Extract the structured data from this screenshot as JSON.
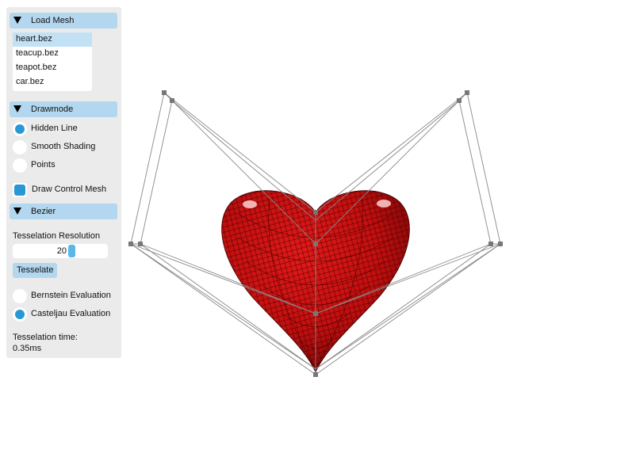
{
  "load_mesh": {
    "title": "Load Mesh",
    "items": [
      "heart.bez",
      "teacup.bez",
      "teapot.bez",
      "car.bez"
    ],
    "selected": "heart.bez"
  },
  "drawmode": {
    "title": "Drawmode",
    "options": [
      "Hidden Line",
      "Smooth Shading",
      "Points"
    ],
    "selected": "Hidden Line",
    "draw_control_mesh_label": "Draw Control Mesh",
    "draw_control_mesh_checked": true
  },
  "bezier": {
    "title": "Bezier",
    "resolution_label": "Tesselation Resolution",
    "resolution_value": "20",
    "tesselate_button": "Tesselate",
    "evaluation_options": [
      "Bernstein Evaluation",
      "Casteljau Evaluation"
    ],
    "evaluation_selected": "Casteljau Evaluation",
    "time_label": "Tesselation time:",
    "time_value": "0.35ms"
  },
  "colors": {
    "accent": "#2898d5",
    "header": "#b3d7ee",
    "panel": "#ebebeb",
    "heart": "#cc1010",
    "control_mesh": "#888888"
  }
}
